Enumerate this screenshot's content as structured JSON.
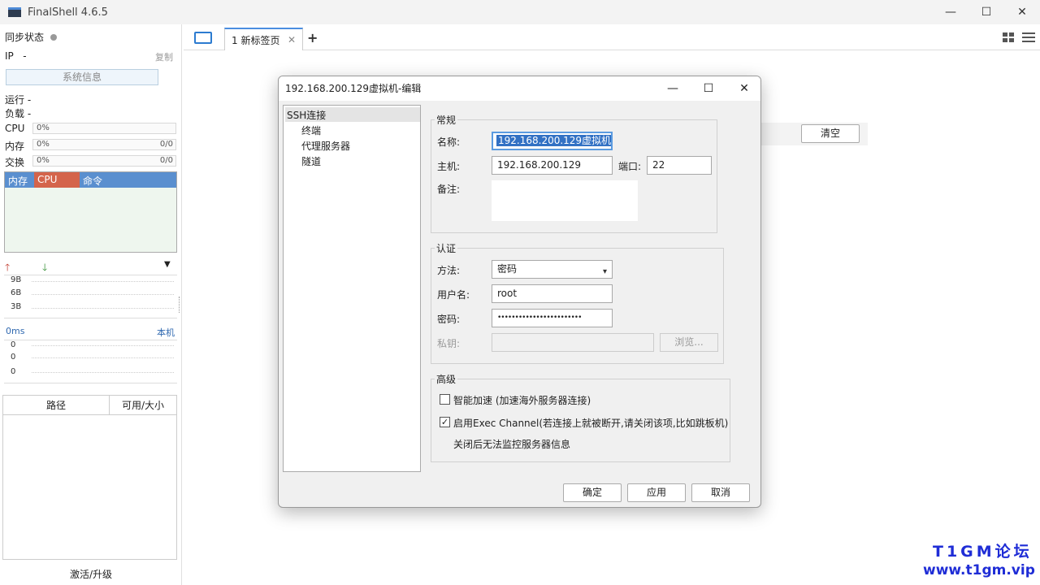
{
  "app": {
    "title": "FinalShell 4.6.5",
    "window_controls": {
      "minimize": "—",
      "maximize": "☐",
      "close": "✕"
    }
  },
  "sidebar": {
    "sync_status": "同步状态",
    "ip_label": "IP",
    "ip_value": "-",
    "copy": "复制",
    "sys_info": "系统信息",
    "running": "运行 -",
    "load": "负载 -",
    "cpu_label": "CPU",
    "cpu_value": "0%",
    "mem_label": "内存",
    "mem_value": "0%",
    "mem_total": "0/0",
    "swap_label": "交换",
    "swap_value": "0%",
    "swap_total": "0/0",
    "proc_columns": [
      "内存",
      "CPU",
      "命令"
    ],
    "net_up": "🡑",
    "net_down": "🡓",
    "net_ticks": [
      "9B",
      "6B",
      "3B"
    ],
    "ping_left": "0ms",
    "ping_right": "本机",
    "ping_ticks": [
      "0",
      "0",
      "0"
    ],
    "path_columns": [
      "路径",
      "可用/大小"
    ],
    "upgrade": "激活/升级"
  },
  "tabs": {
    "active_label": "1 新标签页",
    "close": "✕",
    "add": "+"
  },
  "main": {
    "clear_button": "清空"
  },
  "dialog": {
    "title": "192.168.200.129虚拟机-编辑",
    "tree": {
      "root": "SSH连接",
      "children": [
        "终端",
        "代理服务器",
        "隧道"
      ]
    },
    "general": {
      "title": "常规",
      "name_label": "名称:",
      "name_value": "192.168.200.129虚拟机",
      "host_label": "主机:",
      "host_value": "192.168.200.129",
      "port_label": "端口:",
      "port_value": "22",
      "note_label": "备注:"
    },
    "auth": {
      "title": "认证",
      "method_label": "方法:",
      "method_value": "密码",
      "user_label": "用户名:",
      "user_value": "root",
      "password_label": "密码:",
      "password_value": "••••••••••••••••••••••••",
      "key_label": "私钥:",
      "browse": "浏览..."
    },
    "advanced": {
      "title": "高级",
      "smart_accel": "智能加速 (加速海外服务器连接)",
      "smart_accel_checked": false,
      "exec_channel": "启用Exec Channel(若连接上就被断开,请关闭该项,比如跳板机)",
      "exec_channel_checked": true,
      "exec_note": "关闭后无法监控服务器信息"
    },
    "buttons": {
      "ok": "确定",
      "apply": "应用",
      "cancel": "取消"
    }
  },
  "watermark": {
    "line1": "T1GM论坛",
    "line2": "www.t1gm.vip"
  },
  "colors": {
    "accent": "#4b8ee0",
    "proc_header": "#5a8fcf",
    "cpu_header": "#d4644b",
    "watermark": "#1f2dd6"
  }
}
